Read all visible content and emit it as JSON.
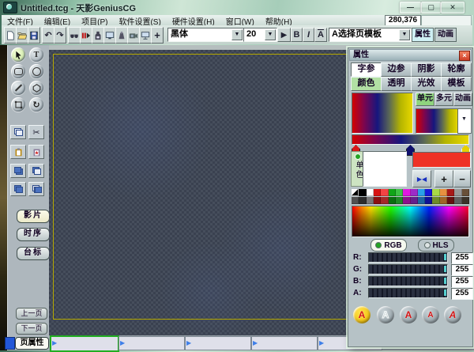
{
  "window": {
    "title": "Untitled.tcg - 天影GeniusCG",
    "coordinates": "280,376"
  },
  "menu": {
    "items": [
      "文件(F)",
      "编辑(E)",
      "项目(P)",
      "软件设置(S)",
      "硬件设置(H)",
      "窗口(W)",
      "帮助(H)"
    ]
  },
  "toolbar": {
    "icons": [
      "new-file",
      "open-file",
      "save",
      "undo",
      "redo",
      "preview",
      "record-play",
      "ink-tool",
      "render-device",
      "signal-device",
      "camera",
      "network-monitor",
      "crosshair"
    ],
    "undo_glyph": "↶",
    "redo_glyph": "↷",
    "crosshair_glyph": "+",
    "font_name": "黑体",
    "font_size": "20",
    "play_glyph": "▶",
    "bold_label": "B",
    "italic_label": "I",
    "underline_label": "A",
    "template_selector": "A选择页模板",
    "panel_toggles": [
      {
        "label": "属性",
        "active": true
      },
      {
        "label": "动画",
        "active": false
      }
    ]
  },
  "tools": {
    "shape_tools": [
      "select",
      "text",
      "rounded-rect",
      "ellipse",
      "line",
      "polygon",
      "transform-rect",
      "rotate"
    ],
    "text_tool_glyph": "T",
    "rotate_glyph": "↻",
    "cut_glyph": "✂",
    "edit_tools": [
      "copy",
      "cut",
      "paste",
      "paste-special",
      "bring-forward",
      "send-backward",
      "group",
      "ungroup"
    ]
  },
  "left_panel": {
    "mode_buttons": [
      {
        "label": "影片",
        "active": true
      },
      {
        "label": "时序",
        "active": false
      },
      {
        "label": "台标",
        "active": false
      }
    ],
    "prev_page": "上一页",
    "next_page": "下一页",
    "page_props": "页属性"
  },
  "properties_panel": {
    "title": "属性",
    "close_glyph": "×",
    "param_tabs": [
      {
        "label": "字参",
        "active": true
      },
      {
        "label": "边参",
        "active": false
      },
      {
        "label": "阴影",
        "active": false
      },
      {
        "label": "轮廓",
        "active": false
      }
    ],
    "attr_tabs": [
      {
        "label": "颜色",
        "active": true
      },
      {
        "label": "透明",
        "active": false
      },
      {
        "label": "光效",
        "active": false
      },
      {
        "label": "模板",
        "active": false
      }
    ],
    "mode_tabs": [
      {
        "label": "单元",
        "active": true
      },
      {
        "label": "多元",
        "active": false
      },
      {
        "label": "动画",
        "active": false
      }
    ],
    "gradient": {
      "css": "linear-gradient(90deg,#d40000 0%,#7a0650 20%,#16167e 42%,#5c6a55 62%,#b4b400 80%,#e8d800 100%)",
      "stops": [
        {
          "color": "#d81818"
        },
        {
          "color": "#10106e"
        },
        {
          "color": "#e8d000"
        }
      ]
    },
    "single_color_label": "单色",
    "swatch_color": "#ffffff",
    "current_color": "#ee3226",
    "buttons": {
      "swap": "▶◀",
      "add": "+",
      "remove": "−"
    },
    "palette_row1": [
      "linear-gradient(135deg,#ffffff 50%,#000000 50%)",
      "#000000",
      "#ffffff",
      "#d81414",
      "#f34343",
      "#10a618",
      "#3cc244",
      "#e018e0",
      "#9c2cc8",
      "#2aa0e8",
      "#1818d8",
      "#a8d846",
      "#e89040",
      "#a81818",
      "#989898",
      "#685038"
    ],
    "palette_row2": [
      "#505050",
      "#2c2c2c",
      "#787878",
      "#8c1010",
      "#a42828",
      "#0a6e10",
      "#1e8826",
      "#8c108c",
      "#641e8c",
      "#1e64a0",
      "#101096",
      "#6e8c28",
      "#a06428",
      "#641010",
      "#5e5e5e",
      "#3a3228"
    ],
    "picker_css": "linear-gradient(to bottom, rgba(0,0,0,0) 0%, rgba(0,0,0,0.9) 100%), linear-gradient(90deg,#ff0000,#ff8000 8%,#ffe000 16%,#20ff00 33%,#00ffff 50%,#0020ff 66%,#ff00ff 83%,#ff0030 100%)",
    "color_spaces": [
      {
        "label": "RGB",
        "active": true
      },
      {
        "label": "HLS",
        "active": false
      }
    ],
    "channels": [
      {
        "label": "R:",
        "value": "255"
      },
      {
        "label": "G:",
        "value": "255"
      },
      {
        "label": "B:",
        "value": "255"
      },
      {
        "label": "A:",
        "value": "255"
      }
    ],
    "style_buttons": [
      {
        "label": "A",
        "active": true
      },
      {
        "label": "A"
      },
      {
        "label": "A"
      },
      {
        "label": "A"
      },
      {
        "label": "A"
      }
    ]
  },
  "page_strip": {
    "count": 5,
    "selected_index": 0
  }
}
